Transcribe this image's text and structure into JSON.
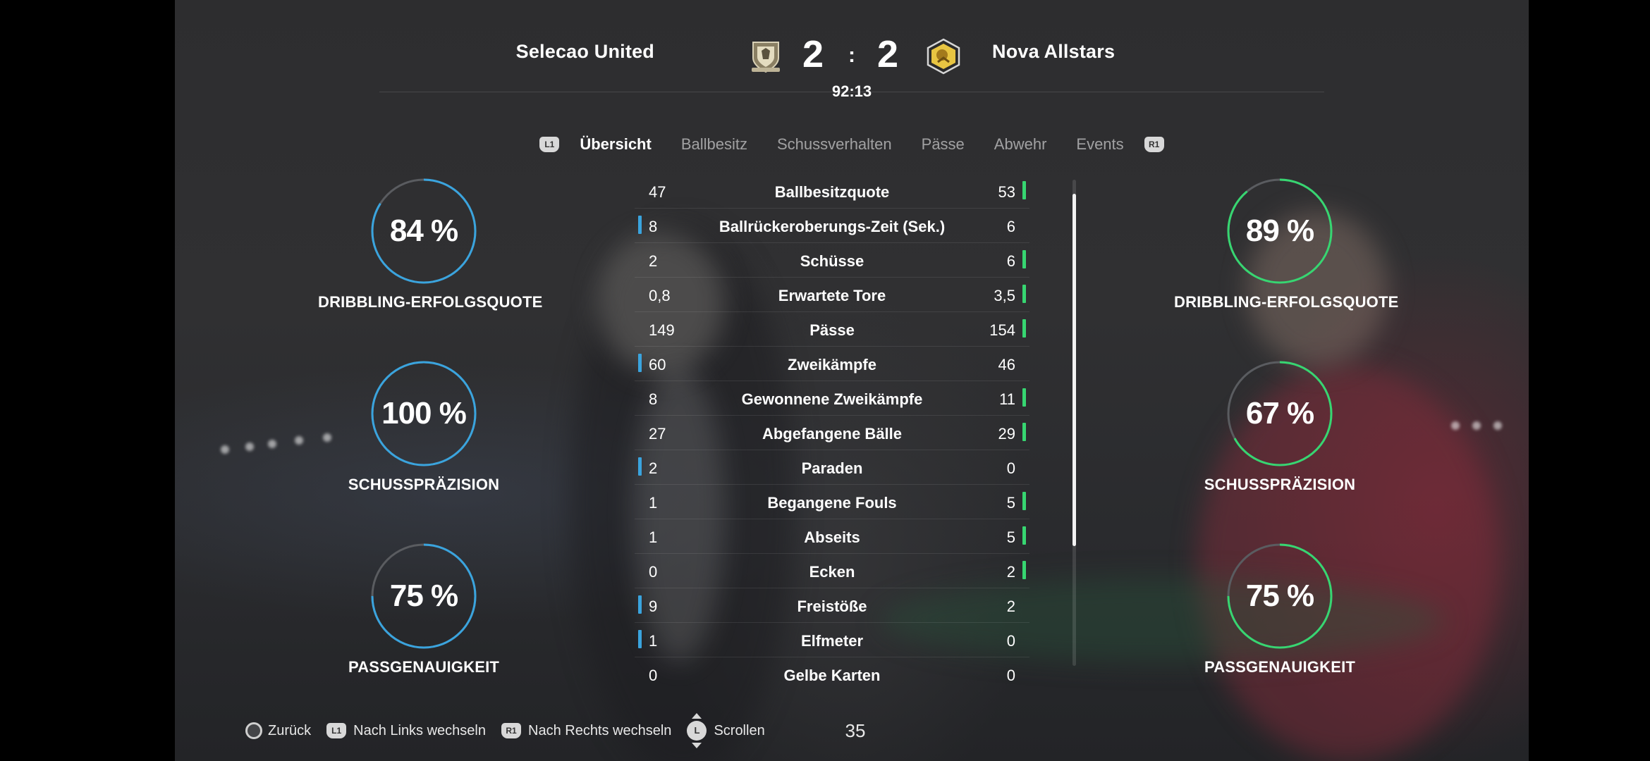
{
  "header": {
    "home_team": "Selecao United",
    "away_team": "Nova Allstars",
    "home_score": "2",
    "away_score": "2",
    "score_separator": ":",
    "match_clock": "92:13"
  },
  "tabs": {
    "left_shoulder": "L1",
    "right_shoulder": "R1",
    "items": [
      {
        "label": "Übersicht",
        "active": true
      },
      {
        "label": "Ballbesitz",
        "active": false
      },
      {
        "label": "Schussverhalten",
        "active": false
      },
      {
        "label": "Pässe",
        "active": false
      },
      {
        "label": "Abwehr",
        "active": false
      },
      {
        "label": "Events",
        "active": false
      }
    ]
  },
  "home_rings": [
    {
      "value": "84 %",
      "fraction": 0.84,
      "label": "DRIBBLING-ERFOLGSQUOTE"
    },
    {
      "value": "100 %",
      "fraction": 1.0,
      "label": "SCHUSSPRÄZISION"
    },
    {
      "value": "75 %",
      "fraction": 0.75,
      "label": "PASSGENAUIGKEIT"
    }
  ],
  "away_rings": [
    {
      "value": "89 %",
      "fraction": 0.89,
      "label": "DRIBBLING-ERFOLGSQUOTE"
    },
    {
      "value": "67 %",
      "fraction": 0.67,
      "label": "SCHUSSPRÄZISION"
    },
    {
      "value": "75 %",
      "fraction": 0.75,
      "label": "PASSGENAUIGKEIT"
    }
  ],
  "colors": {
    "home_accent": "#3aa4de",
    "away_accent": "#37d671",
    "ring_track": "#5a5c60"
  },
  "stats": [
    {
      "name": "Ballbesitzquote",
      "home": "47",
      "away": "53",
      "leader": "away"
    },
    {
      "name": "Ballrückeroberungs-Zeit (Sek.)",
      "home": "8",
      "away": "6",
      "leader": "home"
    },
    {
      "name": "Schüsse",
      "home": "2",
      "away": "6",
      "leader": "away"
    },
    {
      "name": "Erwartete Tore",
      "home": "0,8",
      "away": "3,5",
      "leader": "away"
    },
    {
      "name": "Pässe",
      "home": "149",
      "away": "154",
      "leader": "away"
    },
    {
      "name": "Zweikämpfe",
      "home": "60",
      "away": "46",
      "leader": "home"
    },
    {
      "name": "Gewonnene Zweikämpfe",
      "home": "8",
      "away": "11",
      "leader": "away"
    },
    {
      "name": "Abgefangene Bälle",
      "home": "27",
      "away": "29",
      "leader": "away"
    },
    {
      "name": "Paraden",
      "home": "2",
      "away": "0",
      "leader": "home"
    },
    {
      "name": "Begangene Fouls",
      "home": "1",
      "away": "5",
      "leader": "away"
    },
    {
      "name": "Abseits",
      "home": "1",
      "away": "5",
      "leader": "away"
    },
    {
      "name": "Ecken",
      "home": "0",
      "away": "2",
      "leader": "away"
    },
    {
      "name": "Freistöße",
      "home": "9",
      "away": "2",
      "leader": "home"
    },
    {
      "name": "Elfmeter",
      "home": "1",
      "away": "0",
      "leader": "home"
    },
    {
      "name": "Gelbe Karten",
      "home": "0",
      "away": "0",
      "leader": "none"
    }
  ],
  "footer": {
    "back_label": "Zurück",
    "left_badge": "L1",
    "left_label": "Nach Links wechseln",
    "right_badge": "R1",
    "right_label": "Nach Rechts wechseln",
    "stick_badge": "L",
    "scroll_label": "Scrollen",
    "page_number": "35"
  },
  "icons": {
    "home_crest": "shield-crest-icon",
    "away_crest": "lion-crest-icon",
    "back_button": "circle-button-icon",
    "scroll": "left-stick-icon"
  }
}
